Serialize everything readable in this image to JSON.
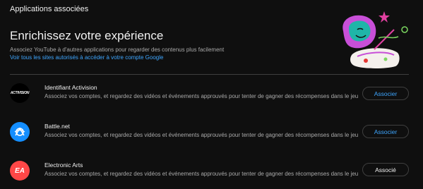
{
  "page": {
    "title": "Applications associées"
  },
  "hero": {
    "title": "Enrichissez votre expérience",
    "description": "Associez YouTube à d'autres applications pour regarder des contenus plus facilement",
    "link": "Voir tous les sites autorisés à accéder à votre compte Google"
  },
  "apps": [
    {
      "name": "Identifiant Activision",
      "logo_text": "ACTIVISION",
      "description": "Associez vos comptes, et regardez des vidéos et événements approuvés pour tenter de gagner des récompenses dans le jeu",
      "button": "Associer"
    },
    {
      "name": "Battle.net",
      "description": "Associez vos comptes, et regardez des vidéos et événements approuvés pour tenter de gagner des récompenses dans le jeu",
      "button": "Associer"
    },
    {
      "name": "Electronic Arts",
      "logo_text": "EA",
      "description": "Associez vos comptes, et regardez des vidéos et événements approuvés pour tenter de gagner des récompenses dans le jeu",
      "button": "Associé"
    }
  ],
  "colors": {
    "background": "#0f0f0f",
    "link": "#3ea6ff",
    "battlenet": "#148eff",
    "ea": "#ff4747"
  }
}
